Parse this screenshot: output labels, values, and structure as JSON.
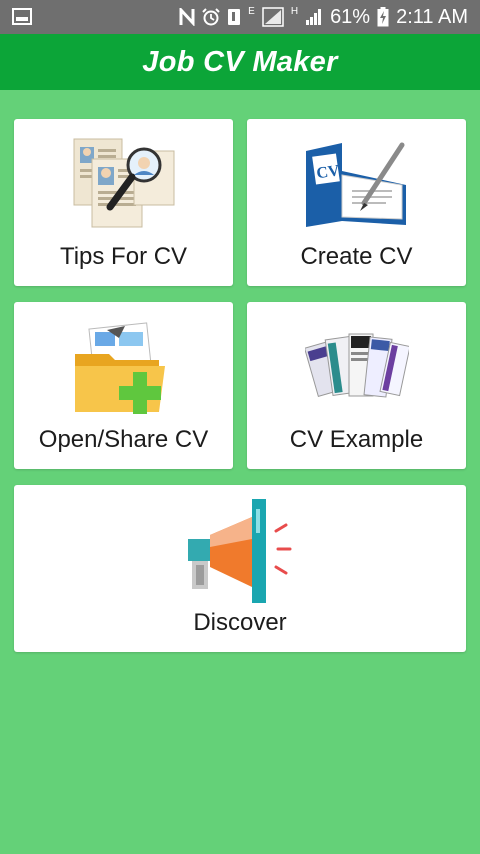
{
  "status_bar": {
    "battery": "61%",
    "time": "2:11 AM",
    "network_e": "E",
    "network_h": "H"
  },
  "app_bar": {
    "title": "Job CV Maker"
  },
  "tiles": [
    {
      "label": "Tips For CV",
      "icon": "resume-magnifier-icon"
    },
    {
      "label": "Create CV",
      "icon": "cv-folder-pen-icon"
    },
    {
      "label": "Open/Share CV",
      "icon": "folder-plus-icon"
    },
    {
      "label": "CV Example",
      "icon": "cv-examples-icon"
    },
    {
      "label": "Discover",
      "icon": "megaphone-icon"
    }
  ],
  "colors": {
    "status_bar": "#6f6f6f",
    "app_bar": "#0ca538",
    "background": "#64d178",
    "tile": "#ffffff"
  }
}
